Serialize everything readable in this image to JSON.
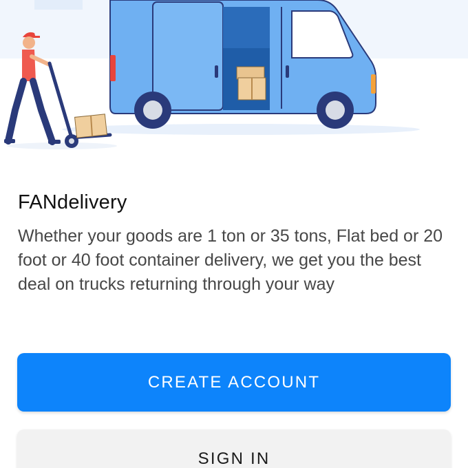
{
  "app": {
    "title": "FANdelivery",
    "description": "Whether your goods are 1 ton or 35 tons, Flat bed or 20 foot or 40 foot container delivery, we get you the best deal on trucks returning through your way"
  },
  "actions": {
    "create_account_label": "CREATE ACCOUNT",
    "sign_in_label": "SIGN IN"
  },
  "hero": {
    "illustration": "delivery-van-illustration",
    "icons": [
      "delivery-man-icon",
      "hand-truck-icon",
      "parcel-box-icon",
      "delivery-van-icon"
    ]
  },
  "colors": {
    "primary": "#0d84fb",
    "secondary_button": "#f2f2f2",
    "van_body": "#6fb0f2",
    "van_outline": "#2a3a7a"
  }
}
